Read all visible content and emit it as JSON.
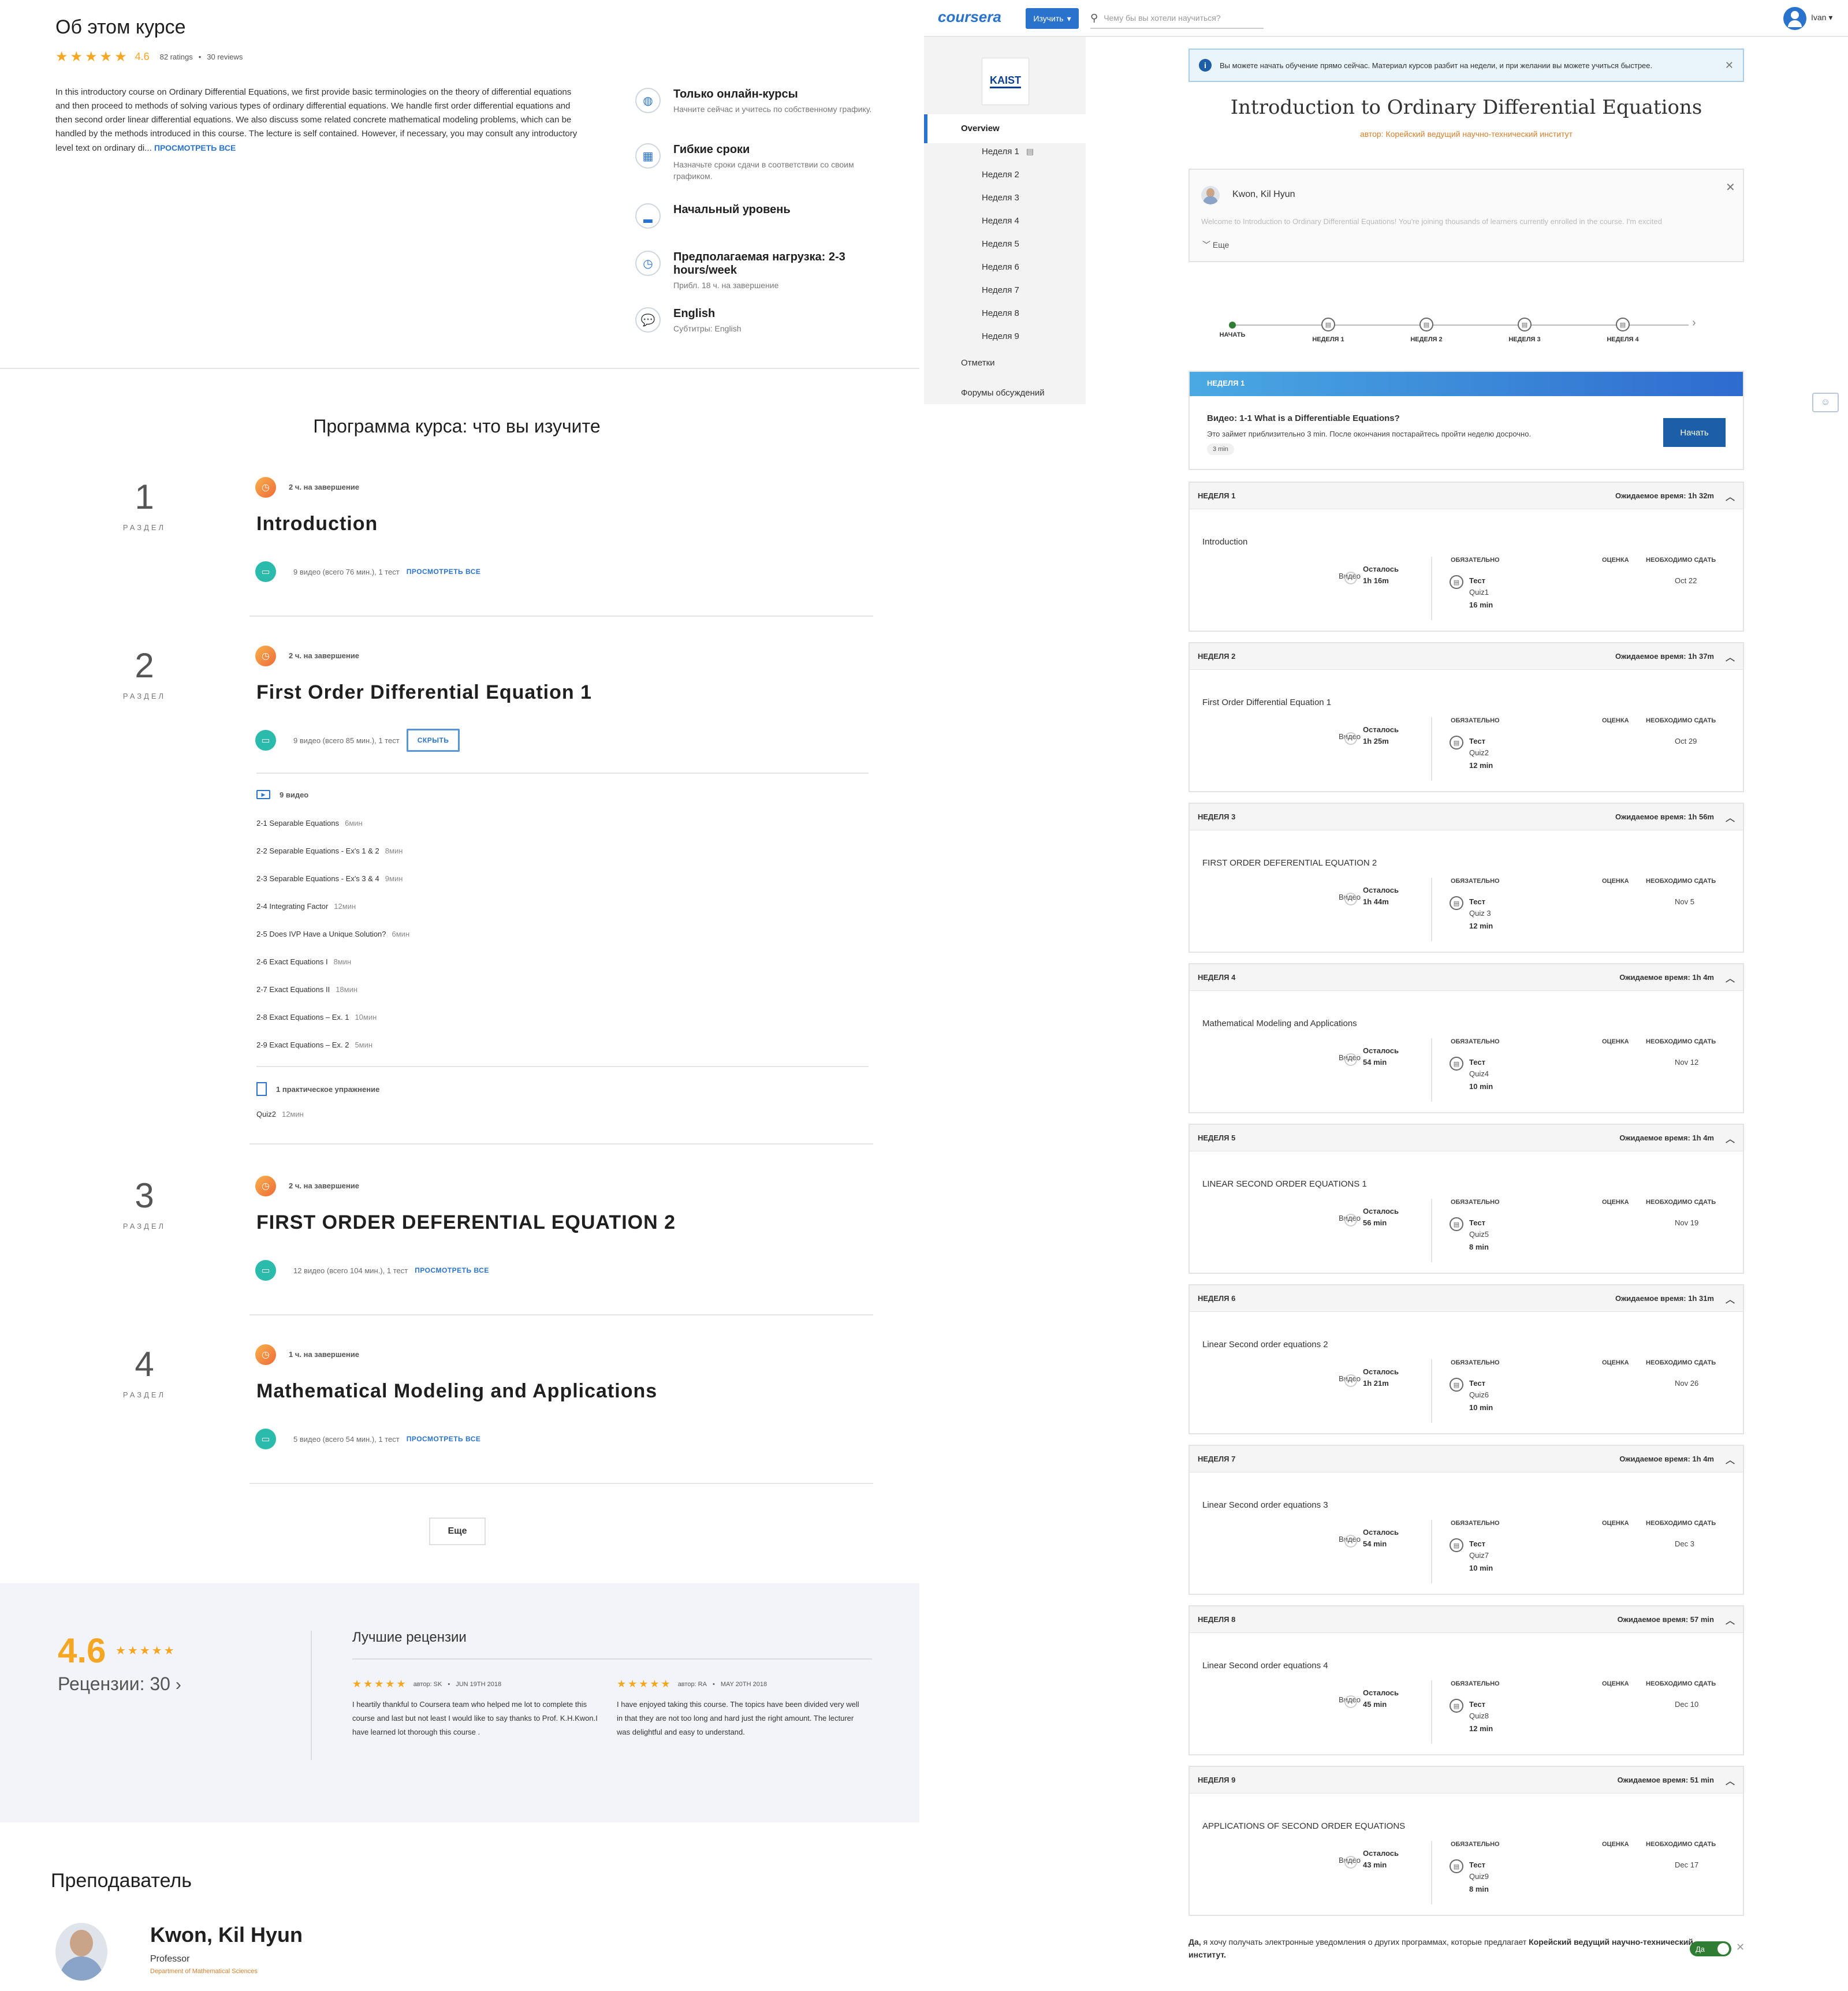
{
  "about": {
    "heading": "Об этом курсе",
    "rating": "4.6",
    "ratings_count": "82 ratings",
    "reviews_count": "30 reviews",
    "description": "In this introductory course on Ordinary Differential Equations, we first provide basic terminologies on the theory of differential equations and then proceed to methods of solving various types of ordinary differential equations. We handle first order differential equations and then second order linear differential equations. We also discuss some related concrete mathematical modeling problems, which can be handled by the methods introduced in this course. The lecture is self contained. However, if necessary, you may consult any introductory level text on ordinary di...",
    "view_all": "ПРОСМОТРЕТЬ ВСЕ",
    "features": [
      {
        "icon": "globe-icon",
        "title": "Только онлайн-курсы",
        "sub": "Начните сейчас и учитесь по собственному графику."
      },
      {
        "icon": "calendar-icon",
        "title": "Гибкие сроки",
        "sub": "Назначьте сроки сдачи в соответствии со своим графиком."
      },
      {
        "icon": "level-icon",
        "title": "Начальный уровень",
        "sub": ""
      },
      {
        "icon": "clock-icon",
        "title": "Предполагаемая нагрузка: 2-3 hours/week",
        "sub": "Прибл. 18 ч. на завершение"
      },
      {
        "icon": "speech-icon",
        "title": "English",
        "sub": "Субтитры: English"
      }
    ]
  },
  "syllabus": {
    "heading": "Программа курса: что вы изучите",
    "section_label": "РАЗДЕЛ",
    "modules": [
      {
        "num": "1",
        "hours": "2 ч. на завершение",
        "title": "Introduction",
        "info": "9 видео (всего 76 мин.), 1 тест",
        "link": "ПРОСМОТРЕТЬ ВСЕ"
      },
      {
        "num": "2",
        "hours": "2 ч. на завершение",
        "title": "First Order Differential Equation 1",
        "info": "9 видео (всего 85 мин.), 1 тест",
        "link": "СКРЫТЬ"
      },
      {
        "num": "3",
        "hours": "2 ч. на завершение",
        "title": "FIRST ORDER DEFERENTIAL EQUATION 2",
        "info": "12 видео (всего 104 мин.), 1 тест",
        "link": "ПРОСМОТРЕТЬ ВСЕ"
      },
      {
        "num": "4",
        "hours": "1 ч. на завершение",
        "title": "Mathematical Modeling and Applications",
        "info": "5 видео (всего 54 мин.), 1 тест",
        "link": "ПРОСМОТРЕТЬ ВСЕ"
      }
    ],
    "videos_header": "9 видео",
    "videos": [
      {
        "t": "2-1 Separable Equations",
        "m": "6мин"
      },
      {
        "t": "2-2 Separable Equations - Ex's 1 & 2",
        "m": "8мин"
      },
      {
        "t": "2-3 Separable Equations - Ex's 3 & 4",
        "m": "9мин"
      },
      {
        "t": "2-4 Integrating Factor",
        "m": "12мин"
      },
      {
        "t": "2-5 Does IVP Have a Unique Solution?",
        "m": "6мин"
      },
      {
        "t": "2-6 Exact Equations I",
        "m": "8мин"
      },
      {
        "t": "2-7 Exact Equations II",
        "m": "18мин"
      },
      {
        "t": "2-8 Exact Equations – Ex. 1",
        "m": "10мин"
      },
      {
        "t": "2-9 Exact Equations – Ex. 2",
        "m": "5мин"
      }
    ],
    "practice_header": "1 практическое упражнение",
    "practice": {
      "t": "Quiz2",
      "m": "12мин"
    },
    "more_button": "Еще"
  },
  "reviews": {
    "rating": "4.6",
    "count_label": "Рецензии: 30",
    "heading": "Лучшие рецензии",
    "items": [
      {
        "author": "автор: SK",
        "date": "JUN 19TH 2018",
        "text": "I heartily thankful to Coursera team who helped me lot to complete this course and last but not least I would like to say thanks to Prof. K.H.Kwon.I have learned lot thorough this course ."
      },
      {
        "author": "автор: RA",
        "date": "MAY 20TH 2018",
        "text": "I have enjoyed taking this course. The topics have been divided very well in that they are not too long and hard just the right amount. The lecturer was delightful and easy to understand."
      }
    ]
  },
  "instructor": {
    "heading": "Преподаватель",
    "name": "Kwon, Kil Hyun",
    "role": "Professor",
    "dept": "Department of Mathematical Sciences"
  },
  "topbar": {
    "logo": "coursera",
    "explore": "Изучить",
    "search_placeholder": "Чему бы вы хотели научиться?",
    "user": "Ivan"
  },
  "sidebar": {
    "uni_logo": "KAIST",
    "overview": "Overview",
    "weeks": [
      "Неделя 1",
      "Неделя 2",
      "Неделя 3",
      "Неделя 4",
      "Неделя 5",
      "Неделя 6",
      "Неделя 7",
      "Неделя 8",
      "Неделя 9"
    ],
    "grades": "Отметки",
    "forums": "Форумы обсуждений"
  },
  "course": {
    "banner": "Вы можете начать обучение прямо сейчас. Материал курсов разбит на недели, и при желании вы можете учиться быстрее.",
    "title": "Introduction to Ordinary Differential Equations",
    "author": "автор: Корейский ведущий научно-технический институт",
    "instructor_name": "Kwon, Kil Hyun",
    "welcome": "Welcome to Introduction to Ordinary Differential Equations! You're joining thousands of learners currently enrolled in the course. I'm excited",
    "more": "Еще",
    "timeline": [
      "НАЧАТЬ",
      "НЕДЕЛЯ 1",
      "НЕДЕЛЯ 2",
      "НЕДЕЛЯ 3",
      "НЕДЕЛЯ 4"
    ],
    "next_week_label": "НЕДЕЛЯ 1",
    "next_video": "Видео: 1-1 What is a Differentiable Equations?",
    "next_desc": "Это займет приблизительно 3 min. После окончания постарайтесь пройти неделю досрочно.",
    "next_dur": "3 min",
    "start_button": "Начать",
    "col_required": "ОБЯЗАТЕЛЬНО",
    "col_grade": "ОЦЕНКА",
    "col_due": "НЕОБХОДИМО СДАТЬ",
    "video_label": "Видео",
    "remaining_label": "Осталось",
    "test_label": "Тест",
    "weeks": [
      {
        "head": "НЕДЕЛЯ 1",
        "est": "Ожидаемое время: 1h 32m",
        "topic": "Introduction",
        "left": "1h 16m",
        "quiz": "Quiz1",
        "qtime": "16 min",
        "due": "Oct 22"
      },
      {
        "head": "НЕДЕЛЯ 2",
        "est": "Ожидаемое время: 1h 37m",
        "topic": "First Order Differential Equation 1",
        "left": "1h 25m",
        "quiz": "Quiz2",
        "qtime": "12 min",
        "due": "Oct 29"
      },
      {
        "head": "НЕДЕЛЯ 3",
        "est": "Ожидаемое время: 1h 56m",
        "topic": "FIRST ORDER DEFERENTIAL EQUATION 2",
        "left": "1h 44m",
        "quiz": "Quiz 3",
        "qtime": "12 min",
        "due": "Nov 5"
      },
      {
        "head": "НЕДЕЛЯ 4",
        "est": "Ожидаемое время: 1h 4m",
        "topic": "Mathematical Modeling and Applications",
        "left": "54 min",
        "quiz": "Quiz4",
        "qtime": "10 min",
        "due": "Nov 12"
      },
      {
        "head": "НЕДЕЛЯ 5",
        "est": "Ожидаемое время: 1h 4m",
        "topic": "LINEAR SECOND ORDER EQUATIONS 1",
        "left": "56 min",
        "quiz": "Quiz5",
        "qtime": "8 min",
        "due": "Nov 19"
      },
      {
        "head": "НЕДЕЛЯ 6",
        "est": "Ожидаемое время: 1h 31m",
        "topic": "Linear Second order equations 2",
        "left": "1h 21m",
        "quiz": "Quiz6",
        "qtime": "10 min",
        "due": "Nov 26"
      },
      {
        "head": "НЕДЕЛЯ 7",
        "est": "Ожидаемое время: 1h 4m",
        "topic": "Linear Second order equations 3",
        "left": "54 min",
        "quiz": "Quiz7",
        "qtime": "10 min",
        "due": "Dec 3"
      },
      {
        "head": "НЕДЕЛЯ 8",
        "est": "Ожидаемое время: 57 min",
        "topic": "Linear Second order equations 4",
        "left": "45 min",
        "quiz": "Quiz8",
        "qtime": "12 min",
        "due": "Dec 10"
      },
      {
        "head": "НЕДЕЛЯ 9",
        "est": "Ожидаемое время: 51 min",
        "topic": "APPLICATIONS OF SECOND ORDER EQUATIONS",
        "left": "43 min",
        "quiz": "Quiz9",
        "qtime": "8 min",
        "due": "Dec 17"
      }
    ],
    "consent_yes": "Да,",
    "consent_text": " я хочу получать электронные уведомления о других программах, которые предлагает ",
    "consent_org": "Корейский ведущий научно-технический институт.",
    "toggle_label": "Да"
  },
  "colors": {
    "accent": "#2a73cc",
    "star": "#f5a623",
    "teal": "#2bbbad",
    "orange": "#ef6a3a",
    "green": "#2e7d32"
  }
}
